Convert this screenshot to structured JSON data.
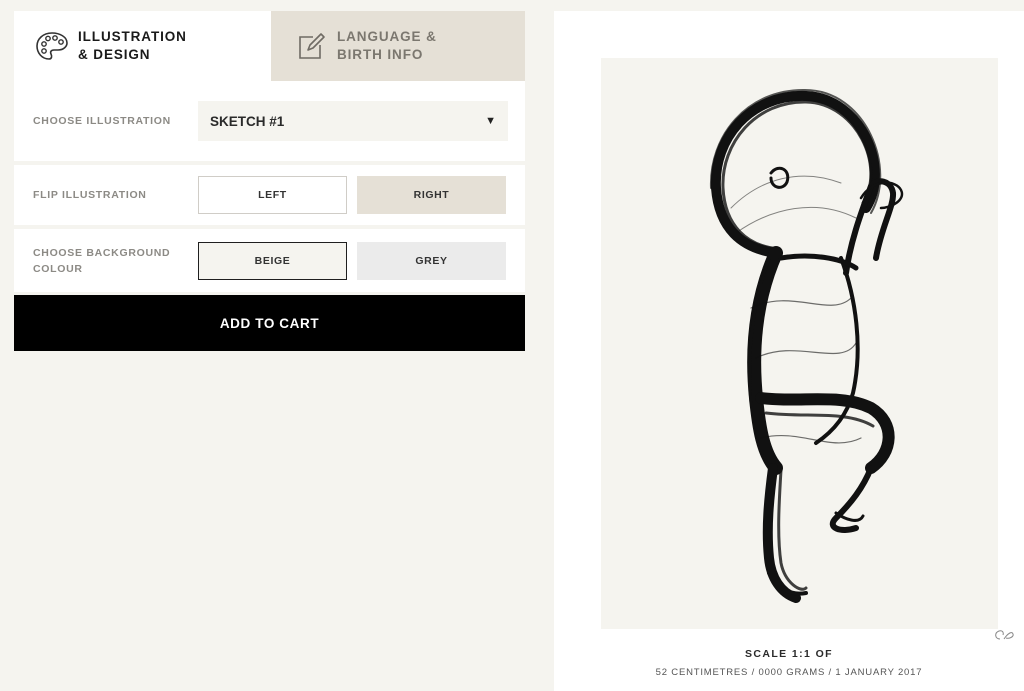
{
  "tabs": {
    "illustration": {
      "line1": "ILLUSTRATION",
      "line2": "& DESIGN",
      "icon": "palette-icon"
    },
    "language": {
      "line1": "LANGUAGE &",
      "line2": "BIRTH INFO",
      "icon": "edit-icon"
    }
  },
  "options": {
    "illustration": {
      "label": "CHOOSE ILLUSTRATION",
      "selected": "SKETCH #1"
    },
    "flip": {
      "label": "FLIP ILLUSTRATION",
      "left": "LEFT",
      "right": "RIGHT",
      "selected": "RIGHT"
    },
    "background": {
      "label_line1": "CHOOSE BACKGROUND",
      "label_line2": "COLOUR",
      "beige": "BEIGE",
      "grey": "GREY",
      "selected": "BEIGE"
    }
  },
  "cart": {
    "label": "ADD TO CART"
  },
  "preview": {
    "scale_title": "SCALE 1:1 OF",
    "details": "52 CENTIMETRES / 0000 GRAMS / 1 JANUARY 2017"
  },
  "colors": {
    "beige": "#f5f4ef",
    "tab_inactive": "#e5e0d6",
    "button": "#000000"
  }
}
